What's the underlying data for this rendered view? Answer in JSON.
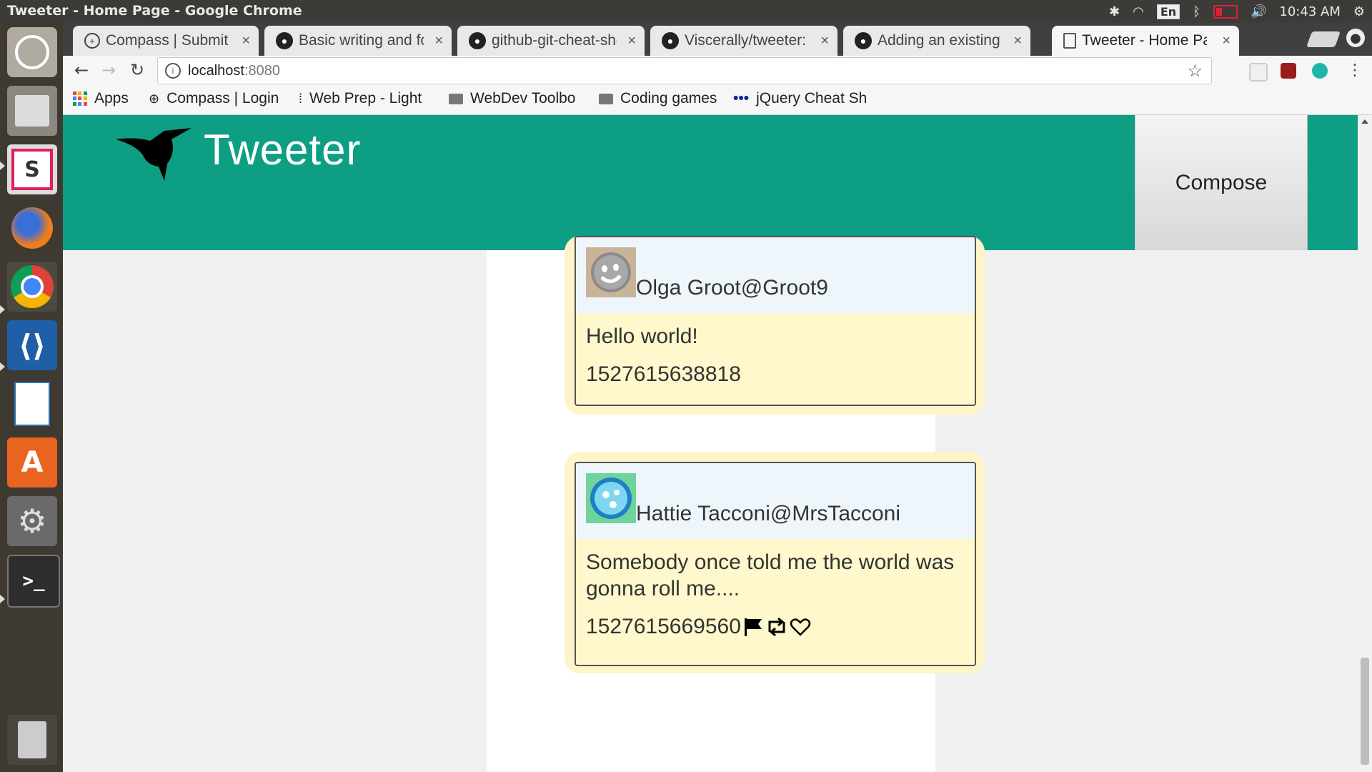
{
  "os": {
    "window_title": "Tweeter - Home Page - Google Chrome",
    "keyboard": "En",
    "clock": "10:43 AM"
  },
  "tabs": [
    {
      "label": "Compass | Submit P",
      "icon": "compass-icon"
    },
    {
      "label": "Basic writing and fo",
      "icon": "github-icon"
    },
    {
      "label": "github-git-cheat-she",
      "icon": "github-icon"
    },
    {
      "label": "Viscerally/tweeter:",
      "icon": "github-icon"
    },
    {
      "label": "Adding an existing p",
      "icon": "github-icon"
    },
    {
      "label": "Tweeter - Home Pag",
      "icon": "page-icon",
      "active": true
    }
  ],
  "toolbar": {
    "url_host": "localhost",
    "url_port": ":8080"
  },
  "bookmarks": [
    {
      "label": "Apps"
    },
    {
      "label": "Compass | Login"
    },
    {
      "label": "Web Prep - Light"
    },
    {
      "label": "WebDev Toolbo"
    },
    {
      "label": "Coding games"
    },
    {
      "label": "jQuery Cheat Sh"
    }
  ],
  "site": {
    "title": "Tweeter",
    "compose_label": "Compose",
    "brand_color": "#0e9e83"
  },
  "tweets": [
    {
      "name_handle": "Olga Groot@Groot9",
      "text": "Hello world!",
      "timestamp": "1527615638818",
      "avatar_color": "#c9b49a",
      "show_actions": false
    },
    {
      "name_handle": "Hattie Tacconi@MrsTacconi",
      "text": "Somebody once told me the world was gonna roll me....",
      "timestamp": "1527615669560",
      "avatar_color": "#6fd39b",
      "show_actions": true,
      "actions": [
        "flag-icon",
        "retweet-icon",
        "heart-icon"
      ]
    }
  ]
}
